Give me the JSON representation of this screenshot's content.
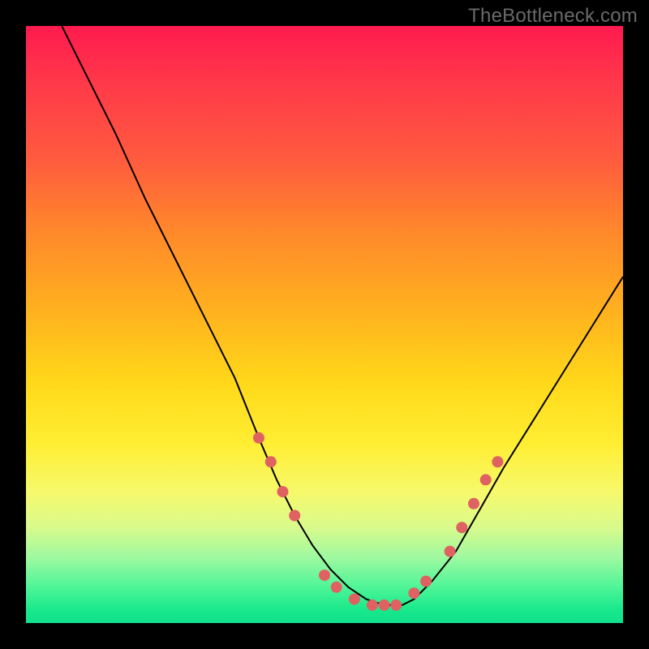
{
  "watermark": "TheBottleneck.com",
  "chart_data": {
    "type": "line",
    "title": "",
    "xlabel": "",
    "ylabel": "",
    "xlim": [
      0,
      100
    ],
    "ylim": [
      0,
      100
    ],
    "series": [
      {
        "name": "curve",
        "x": [
          6,
          10,
          15,
          20,
          25,
          30,
          35,
          39,
          42,
          45,
          48,
          51,
          54,
          57,
          60,
          63,
          65,
          68,
          72,
          76,
          80,
          85,
          90,
          95,
          100
        ],
        "y": [
          100,
          92,
          82,
          71,
          61,
          51,
          41,
          31,
          24,
          18,
          13,
          9,
          6,
          4,
          3,
          3,
          4,
          7,
          12,
          19,
          26,
          34,
          42,
          50,
          58
        ]
      }
    ],
    "markers": [
      {
        "name": "left-band-start",
        "x": 39,
        "y": 31
      },
      {
        "name": "left-band-2",
        "x": 41,
        "y": 27
      },
      {
        "name": "left-band-3",
        "x": 43,
        "y": 22
      },
      {
        "name": "left-band-end",
        "x": 45,
        "y": 18
      },
      {
        "name": "valley-left-1",
        "x": 50,
        "y": 8
      },
      {
        "name": "valley-left-2",
        "x": 52,
        "y": 6
      },
      {
        "name": "valley-bottom-1",
        "x": 55,
        "y": 4
      },
      {
        "name": "valley-bottom-2",
        "x": 58,
        "y": 3
      },
      {
        "name": "valley-bottom-3",
        "x": 60,
        "y": 3
      },
      {
        "name": "valley-bottom-4",
        "x": 62,
        "y": 3
      },
      {
        "name": "valley-right-1",
        "x": 65,
        "y": 5
      },
      {
        "name": "valley-right-2",
        "x": 67,
        "y": 7
      },
      {
        "name": "right-band-start",
        "x": 71,
        "y": 12
      },
      {
        "name": "right-band-2",
        "x": 73,
        "y": 16
      },
      {
        "name": "right-band-3",
        "x": 75,
        "y": 20
      },
      {
        "name": "right-band-4",
        "x": 77,
        "y": 24
      },
      {
        "name": "right-band-end",
        "x": 79,
        "y": 27
      }
    ],
    "marker_style": {
      "color": "#e06161",
      "radius_px": 7
    }
  }
}
